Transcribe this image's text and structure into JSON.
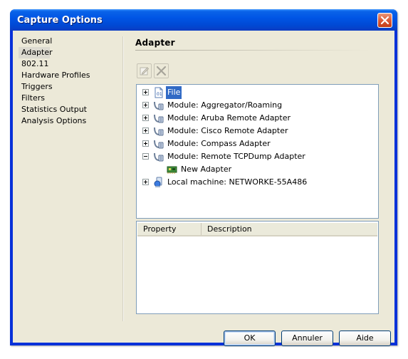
{
  "window": {
    "title": "Capture Options"
  },
  "nav": {
    "items": [
      "General",
      "Adapter",
      "802.11",
      "Hardware Profiles",
      "Triggers",
      "Filters",
      "Statistics Output",
      "Analysis Options"
    ],
    "selected": "Adapter"
  },
  "section": {
    "title": "Adapter"
  },
  "toolbar": {
    "edit_icon": "edit-icon",
    "delete_icon": "delete-icon"
  },
  "tree": {
    "items": [
      {
        "label": "File",
        "icon": "file-icon",
        "expander": "plus",
        "selected": true
      },
      {
        "label": "Module: Aggregator/Roaming",
        "icon": "module-icon",
        "expander": "plus"
      },
      {
        "label": "Module: Aruba Remote Adapter",
        "icon": "module-icon",
        "expander": "plus"
      },
      {
        "label": "Module: Cisco Remote Adapter",
        "icon": "module-icon",
        "expander": "plus"
      },
      {
        "label": "Module: Compass Adapter",
        "icon": "module-icon",
        "expander": "plus"
      },
      {
        "label": "Module: Remote TCPDump Adapter",
        "icon": "module-icon",
        "expander": "minus"
      },
      {
        "label": "New Adapter",
        "icon": "network-card-icon",
        "expander": "none",
        "child": true
      },
      {
        "label": "Local machine: NETWORKE-55A486",
        "icon": "local-machine-icon",
        "expander": "plus"
      }
    ]
  },
  "properties": {
    "columns": [
      "Property",
      "Description"
    ]
  },
  "buttons": {
    "ok": "OK",
    "cancel": "Annuler",
    "help": "Aide"
  },
  "colors": {
    "titlebar": "#0055e5",
    "selection": "#316ac5",
    "dialog_bg": "#ece9d8"
  }
}
